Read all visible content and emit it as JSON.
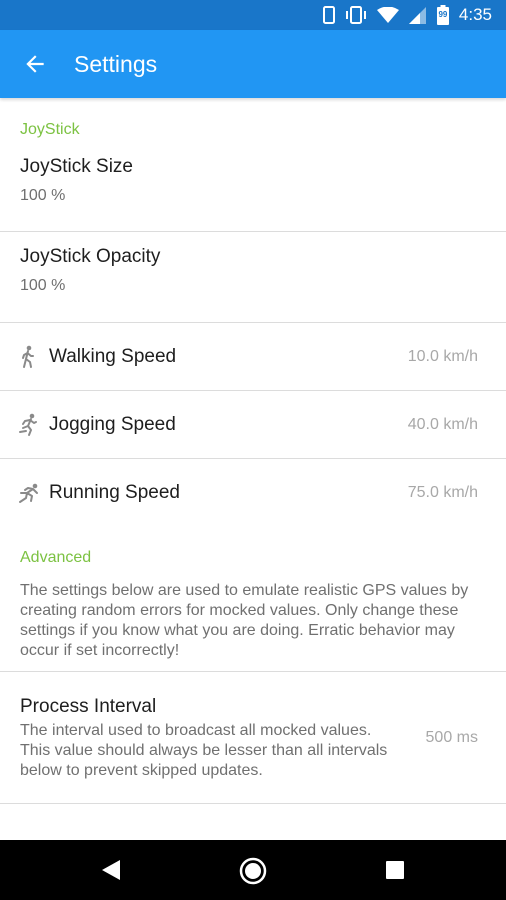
{
  "status_bar": {
    "time": "4:35",
    "battery_level": "99",
    "icons": [
      "phone-icon",
      "vibrate-icon",
      "wifi-icon",
      "signal-icon",
      "battery-icon"
    ]
  },
  "app_bar": {
    "title": "Settings",
    "back_icon": "arrow-back-icon",
    "color": "#2196f3"
  },
  "sections": {
    "joystick": {
      "header": "JoyStick",
      "size": {
        "title": "JoyStick Size",
        "value": "100 %"
      },
      "opacity": {
        "title": "JoyStick Opacity",
        "value": "100 %"
      },
      "walking": {
        "title": "Walking Speed",
        "value": "10.0 km/h",
        "icon": "walking-icon"
      },
      "jogging": {
        "title": "Jogging Speed",
        "value": "40.0 km/h",
        "icon": "jogging-icon"
      },
      "running": {
        "title": "Running Speed",
        "value": "75.0 km/h",
        "icon": "running-icon"
      }
    },
    "advanced": {
      "header": "Advanced",
      "description": "The settings below are used to emulate realistic GPS values by creating random errors for mocked values. Only change these settings if you know what you are doing. Erratic behavior may occur if set incorrectly!",
      "process_interval": {
        "title": "Process Interval",
        "summary": "The interval used to broadcast all mocked values. This value should always be lesser than all intervals below to prevent skipped updates.",
        "value": "500 ms"
      }
    }
  },
  "accent_color": "#7cc242",
  "nav_bar": {
    "icons": [
      "back-triangle-icon",
      "home-circle-icon",
      "recents-square-icon"
    ]
  }
}
